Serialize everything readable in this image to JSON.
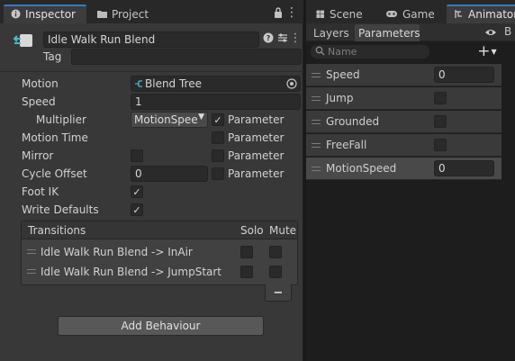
{
  "inspector": {
    "tabs": [
      {
        "label": "Inspector",
        "icon": "info-icon",
        "active": true
      },
      {
        "label": "Project",
        "icon": "folder-icon",
        "active": false
      }
    ],
    "state_name": "Idle Walk Run Blend",
    "tag_label": "Tag",
    "tag_value": "",
    "fields": {
      "motion_label": "Motion",
      "motion_value": "Blend Tree",
      "speed_label": "Speed",
      "speed_value": "1",
      "multiplier_label": "Multiplier",
      "multiplier_value": "MotionSpeed",
      "multiplier_parameter_checked": true,
      "parameter_label": "Parameter",
      "motion_time_label": "Motion Time",
      "motion_time_parameter_checked": false,
      "mirror_label": "Mirror",
      "mirror_checked": false,
      "mirror_parameter_checked": false,
      "cycle_offset_label": "Cycle Offset",
      "cycle_offset_value": "0",
      "cycle_offset_parameter_checked": false,
      "foot_ik_label": "Foot IK",
      "foot_ik_checked": true,
      "write_defaults_label": "Write Defaults",
      "write_defaults_checked": true
    },
    "transitions": {
      "header": "Transitions",
      "solo_label": "Solo",
      "mute_label": "Mute",
      "rows": [
        {
          "name": "Idle Walk Run Blend -> InAir",
          "solo": false,
          "mute": false
        },
        {
          "name": "Idle Walk Run Blend -> JumpStart",
          "solo": false,
          "mute": false
        }
      ],
      "remove_label": "−"
    },
    "add_behaviour_label": "Add Behaviour"
  },
  "animator": {
    "tabs": [
      {
        "label": "Scene",
        "icon": "scene-icon"
      },
      {
        "label": "Game",
        "icon": "gamepad-icon"
      },
      {
        "label": "Animator",
        "icon": "animator-icon",
        "active": true
      }
    ],
    "subtabs": [
      "Layers",
      "Parameters"
    ],
    "search_placeholder": "Name",
    "add_label": "+",
    "parameters": [
      {
        "name": "Speed",
        "type": "float",
        "value": "0",
        "selected": false
      },
      {
        "name": "Jump",
        "type": "bool",
        "value": false,
        "selected": false
      },
      {
        "name": "Grounded",
        "type": "bool",
        "value": false,
        "selected": false
      },
      {
        "name": "FreeFall",
        "type": "bool",
        "value": false,
        "selected": false
      },
      {
        "name": "MotionSpeed",
        "type": "float",
        "value": "0",
        "selected": true
      }
    ]
  },
  "colors": {
    "accent": "#3a79bb",
    "panel": "#383838",
    "field": "#2a2a2a"
  }
}
